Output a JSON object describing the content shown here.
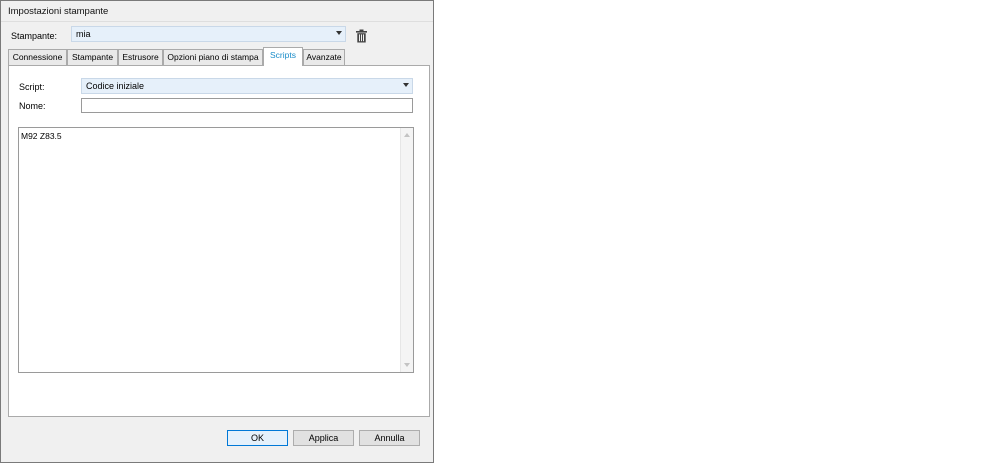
{
  "window": {
    "title": "Impostazioni stampante"
  },
  "printer": {
    "label": "Stampante:",
    "value": "mia",
    "delete_icon": "trash-icon"
  },
  "tabs": [
    {
      "label": "Connessione",
      "active": false
    },
    {
      "label": "Stampante",
      "active": false
    },
    {
      "label": "Estrusore",
      "active": false
    },
    {
      "label": "Opzioni piano di stampa",
      "active": false
    },
    {
      "label": "Scripts",
      "active": true
    },
    {
      "label": "Avanzate",
      "active": false
    }
  ],
  "scripts": {
    "script_label": "Script:",
    "script_value": "Codice iniziale",
    "name_label": "Nome:",
    "name_value": "",
    "code": "M92 Z83.5"
  },
  "buttons": {
    "ok": "OK",
    "apply": "Applica",
    "cancel": "Annulla"
  },
  "colors": {
    "active_tab_text": "#1a8cc8",
    "combo_background": "#e6f0fa",
    "primary_button_border": "#0078d7"
  }
}
